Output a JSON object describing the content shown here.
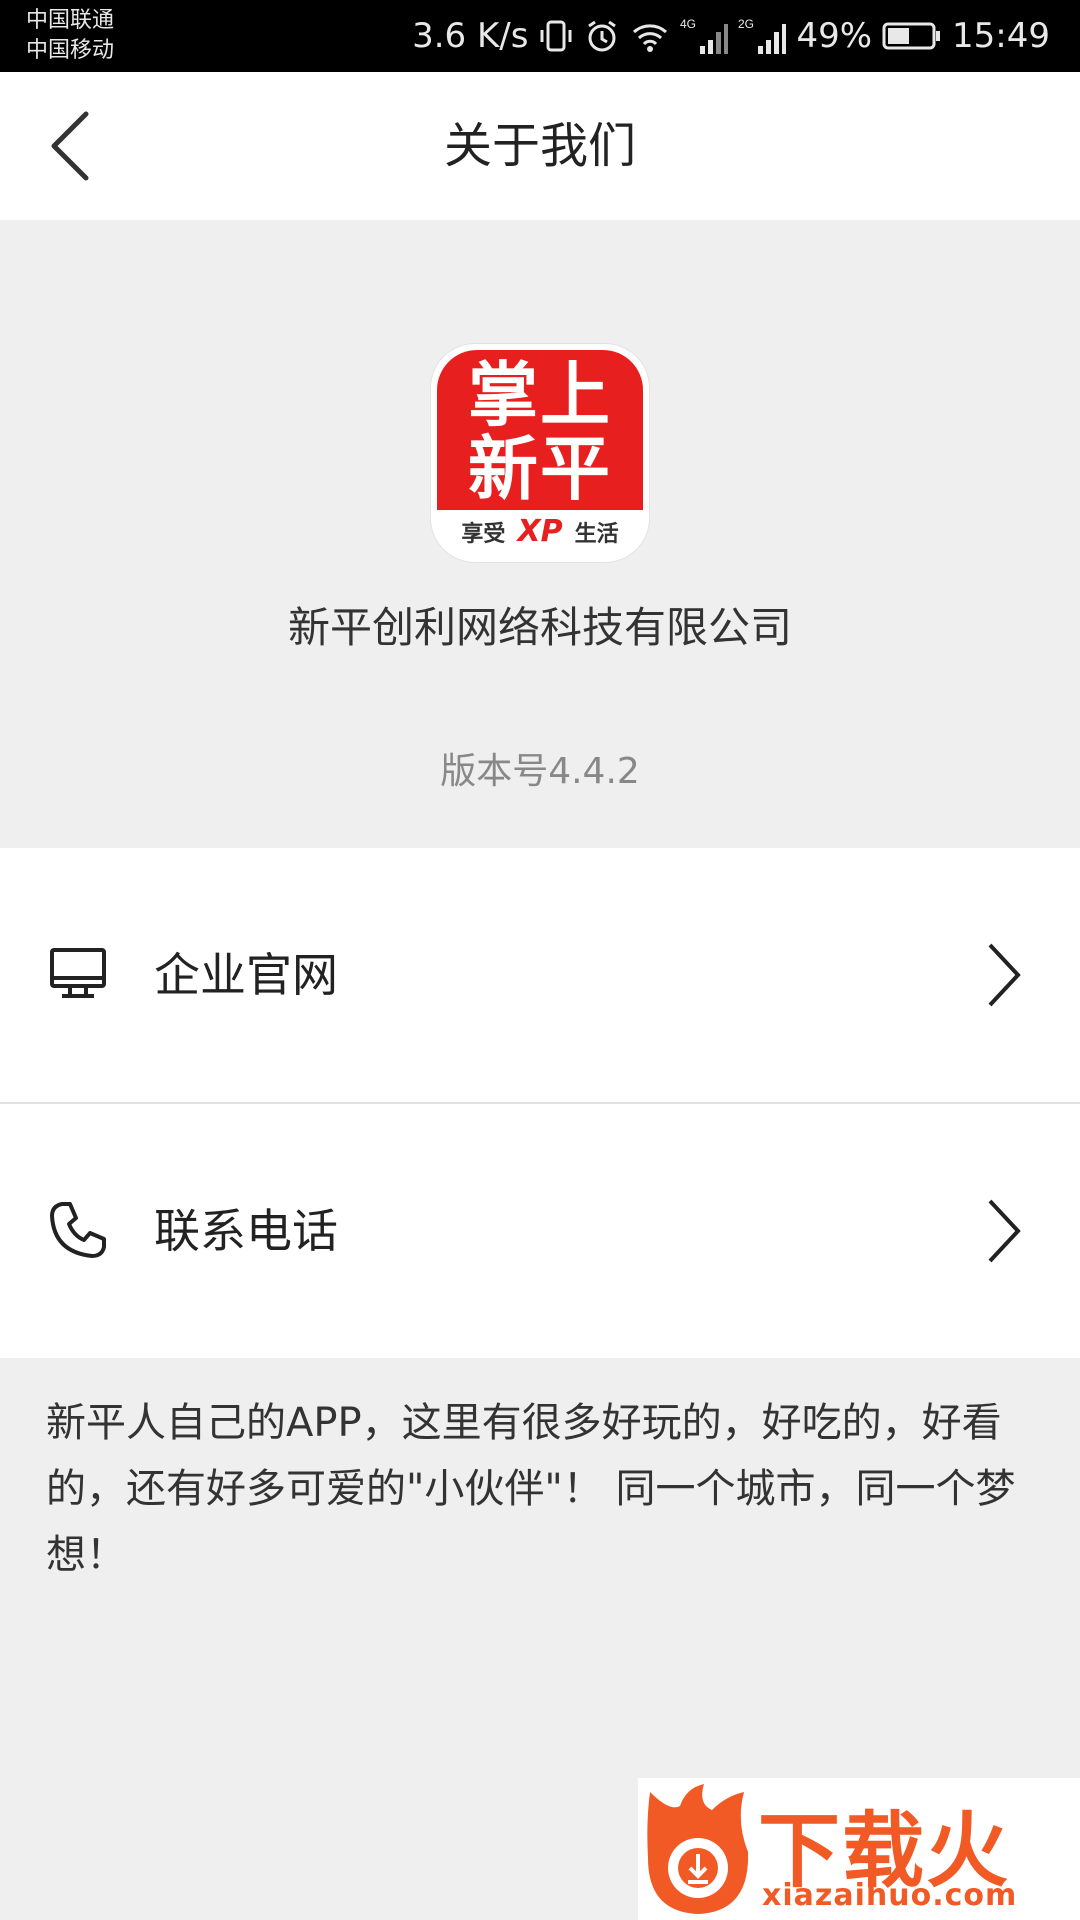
{
  "status_bar": {
    "carrier1": "中国联通",
    "carrier2": "中国移动",
    "speed": "3.6 K/s",
    "battery": "49%",
    "time": "15:49",
    "net1": "4G",
    "net2": "2G"
  },
  "nav": {
    "title": "关于我们"
  },
  "header": {
    "logo_line1": "掌上",
    "logo_line2": "新平",
    "logo_tag_left": "享受",
    "logo_tag_mid": "XP",
    "logo_tag_right": "生活",
    "company": "新平创利网络科技有限公司",
    "version": "版本号4.4.2"
  },
  "menu": {
    "website_label": "企业官网",
    "phone_label": "联系电话"
  },
  "description": "新平人自己的APP，这里有很多好玩的，好吃的，好看的，还有好多可爱的\"小伙伴\"！ 同一个城市，同一个梦想！",
  "watermark": {
    "brand": "下载火",
    "url": "xiazaihuo.com"
  },
  "colors": {
    "accent_red": "#e81f1f",
    "watermark_orange": "#f15a24",
    "background": "#efefef"
  }
}
